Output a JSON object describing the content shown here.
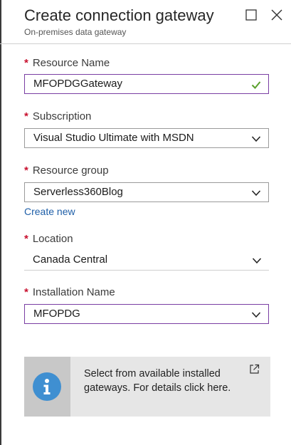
{
  "header": {
    "title": "Create connection gateway",
    "subtitle": "On-premises data gateway"
  },
  "form": {
    "resource_name": {
      "label": "Resource Name",
      "value": "MFOPDGGateway",
      "valid_icon": "checkmark-icon"
    },
    "subscription": {
      "label": "Subscription",
      "value": "Visual Studio Ultimate with MSDN"
    },
    "resource_group": {
      "label": "Resource group",
      "value": "Serverless360Blog",
      "create_new": "Create new"
    },
    "location": {
      "label": "Location",
      "value": "Canada Central"
    },
    "installation_name": {
      "label": "Installation Name",
      "value": "MFOPDG"
    }
  },
  "info": {
    "text": "Select from available installed gateways. For details click here.",
    "icon": "info-icon",
    "link_icon": "external-link-icon"
  },
  "colors": {
    "required": "#c8102e",
    "focus_border": "#7a3ea3",
    "link": "#1f5fa8",
    "valid": "#5aa02c",
    "info_icon": "#3f8fd1"
  }
}
